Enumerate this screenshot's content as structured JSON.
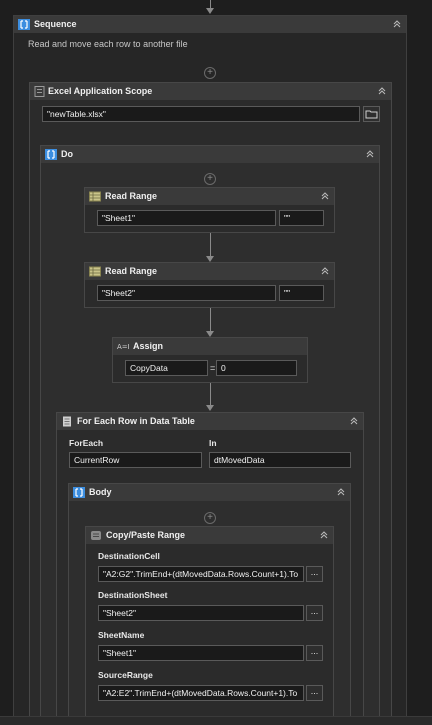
{
  "sequence": {
    "title": "Sequence",
    "annotation": "Read and move each row to another file"
  },
  "excel_scope": {
    "title": "Excel Application Scope",
    "file_path": "\"newTable.xlsx\""
  },
  "do_block": {
    "title": "Do"
  },
  "read_range_1": {
    "title": "Read Range",
    "sheet": "\"Sheet1\"",
    "range": "\"\""
  },
  "read_range_2": {
    "title": "Read Range",
    "sheet": "\"Sheet2\"",
    "range": "\"\""
  },
  "assign": {
    "title": "Assign",
    "to": "CopyData",
    "operator": "=",
    "value": "0"
  },
  "for_each": {
    "title": "For Each Row in Data Table",
    "foreach_label": "ForEach",
    "in_label": "In",
    "foreach_value": "CurrentRow",
    "in_value": "dtMovedData"
  },
  "body_block": {
    "title": "Body"
  },
  "copy_paste": {
    "title": "Copy/Paste Range",
    "dest_cell_label": "DestinationCell",
    "dest_cell_value": "\"A2:G2\".TrimEnd+(dtMovedData.Rows.Count+1).To",
    "dest_sheet_label": "DestinationSheet",
    "dest_sheet_value": "\"Sheet2\"",
    "sheet_name_label": "SheetName",
    "sheet_name_value": "\"Sheet1\"",
    "source_range_label": "SourceRange",
    "source_range_value": "\"A2:E2\".TrimEnd+(dtMovedData.Rows.Count+1).To",
    "ellipsis": "..."
  },
  "colors": {
    "canvas": "#1e1e1e",
    "panel": "#262626",
    "header": "#3a3a3a",
    "accent": "#3c8ee0",
    "excel_icon": "#c9c48a"
  },
  "icons": [
    "sequence-icon",
    "excel-scope-icon",
    "do-icon",
    "read-range-icon",
    "assign-icon",
    "for-each-icon",
    "body-icon",
    "copy-paste-icon",
    "folder-icon",
    "collapse-icon",
    "add-activity-icon"
  ]
}
